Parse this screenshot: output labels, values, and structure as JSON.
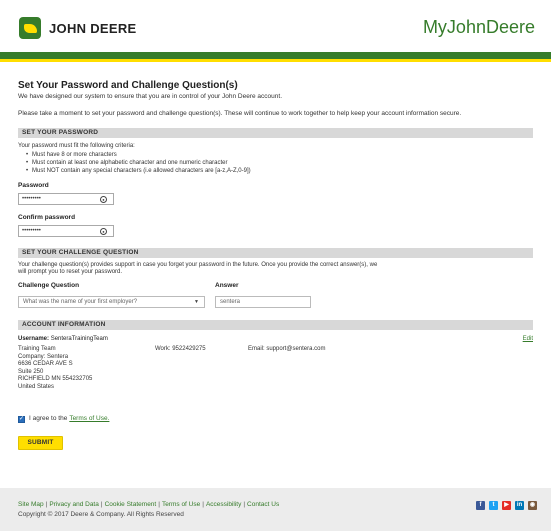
{
  "header": {
    "logo_text": "JOHN DEERE",
    "brand_title": "MyJohnDeere"
  },
  "colors": {
    "brand_green": "#367c2b",
    "brand_yellow": "#ffde00",
    "checkbox_blue": "#2a6ebb"
  },
  "intro": {
    "title": "Set Your Password and Challenge Question(s)",
    "line1": "We have designed our system to ensure that you are in control of your John Deere account.",
    "line2": "Please take a moment to set your password and challenge question(s). These will continue to work together to help keep your account information secure."
  },
  "password_section": {
    "header": "SET YOUR PASSWORD",
    "criteria_intro": "Your password must fit the following criteria:",
    "criteria": [
      "Must have 8 or more characters",
      "Must contain at least one alphabetic character and one numeric character",
      "Must NOT contain any special characters (i.e allowed characters are [a-z,A-Z,0-9])"
    ],
    "password_label": "Password",
    "password_value": "•••••••••",
    "confirm_label": "Confirm password",
    "confirm_value": "•••••••••"
  },
  "challenge_section": {
    "header": "SET YOUR CHALLENGE QUESTION",
    "intro": "Your challenge question(s) provides support in case you forget your password in the future. Once you provide the correct answer(s), we will prompt you to reset your password.",
    "question_label": "Challenge Question",
    "answer_label": "Answer",
    "question_value": "What was the name of your first employer?",
    "answer_value": "sentera"
  },
  "account_section": {
    "header": "ACCOUNT INFORMATION",
    "username_label": "Username:",
    "username_value": "SenteraTrainingTeam",
    "edit_label": "Edit",
    "address_lines": [
      "Training Team",
      "Company: Sentera",
      "6636 CEDAR AVE S",
      "Suite 250",
      "RICHFIELD MN 554232705",
      "United States"
    ],
    "work": "Work: 9522429275",
    "email": "Email: support@sentera.com"
  },
  "agree": {
    "text": "I agree to the",
    "link": "Terms of Use."
  },
  "submit_label": "SUBMIT",
  "footer": {
    "links": [
      "Site Map",
      "Privacy and Data",
      "Cookie Statement",
      "Terms of Use",
      "Accessibility",
      "Contact Us"
    ],
    "separator": "|",
    "copyright": "Copyright © 2017 Deere & Company. All Rights Reserved",
    "social_icons": [
      "facebook-icon",
      "twitter-icon",
      "youtube-icon",
      "linkedin-icon",
      "instagram-icon"
    ]
  }
}
